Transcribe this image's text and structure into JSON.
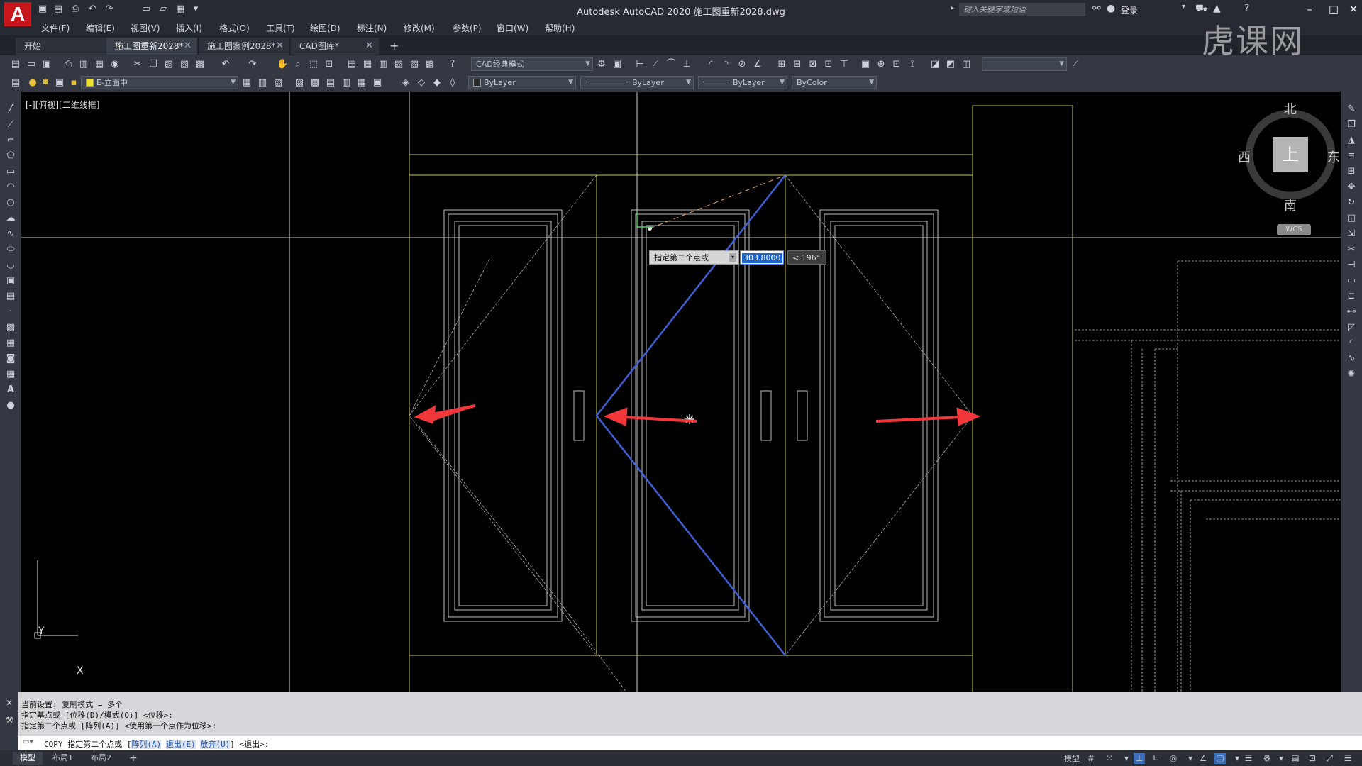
{
  "title": {
    "app_title": "Autodesk AutoCAD 2020    施工图重新2028.dwg",
    "search_placeholder": "键入关键字或短语",
    "login": "登录"
  },
  "menu": [
    "文件(F)",
    "编辑(E)",
    "视图(V)",
    "插入(I)",
    "格式(O)",
    "工具(T)",
    "绘图(D)",
    "标注(N)",
    "修改(M)",
    "参数(P)",
    "窗口(W)",
    "帮助(H)"
  ],
  "tabs": [
    {
      "label": "开始",
      "active": false
    },
    {
      "label": "施工图重新2028*",
      "active": true
    },
    {
      "label": "施工图案例2028*",
      "active": false
    },
    {
      "label": "CAD图库*",
      "active": false
    }
  ],
  "toolbar": {
    "workspace": "CAD经典模式",
    "layer": "E-立面中",
    "color": "ByLayer",
    "linetype": "ByLayer",
    "lineweight": "ByLayer",
    "plotstyle": "ByColor"
  },
  "viewport": {
    "label": "[-][俯视][二维线框]"
  },
  "viewcube": {
    "north": "北",
    "south": "南",
    "east": "东",
    "west": "西",
    "top": "上",
    "wcs": "WCS"
  },
  "ucs": {
    "x": "X",
    "y": "Y"
  },
  "dynamic_input": {
    "prompt": "指定第二个点或",
    "value": "303.8000",
    "angle": "< 196°"
  },
  "command": {
    "history": [
      "当前设置:  复制模式 = 多个",
      "指定基点或 [位移(D)/模式(O)] <位移>:",
      "指定第二个点或 [阵列(A)] <使用第一个点作为位移>:"
    ],
    "prefix": "COPY 指定第二个点或 [",
    "opt1": "阵列(A)",
    "opt2": "退出(E)",
    "opt3": "放弃(U)",
    "suffix": "] <退出>:"
  },
  "layouts": [
    {
      "label": "模型",
      "active": true
    },
    {
      "label": "布局1",
      "active": false
    },
    {
      "label": "布局2",
      "active": false
    }
  ],
  "status": {
    "model": "模型"
  },
  "watermark": "虎课网",
  "colors": {
    "drawing_yellow": "#c8c45a",
    "drawing_white": "#d9d9d9",
    "rubber_band": "#3f5fd6",
    "arrow_red": "#f2373a"
  }
}
